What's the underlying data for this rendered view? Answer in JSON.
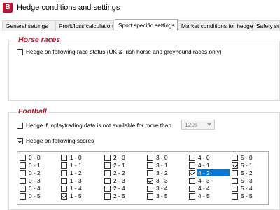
{
  "window": {
    "title": "Hedge conditions and settings",
    "icon_letter": "B"
  },
  "tabs": [
    {
      "label": "General settings",
      "active": false
    },
    {
      "label": "Profit/loss calculation",
      "active": false
    },
    {
      "label": "Sport specific settings",
      "active": true
    },
    {
      "label": "Market conditions for hedge",
      "active": false
    },
    {
      "label": "Safety se",
      "active": false
    }
  ],
  "horse_races": {
    "title": "Horse races",
    "race_status_option": {
      "label": "Hedge on following race status (UK & Irish horse and greyhound races only)",
      "checked": false
    }
  },
  "football": {
    "title": "Football",
    "inplay_option": {
      "label": "Hedge if Inplaytrading data is not available for more than",
      "checked": false
    },
    "timeout": {
      "value": "120s"
    },
    "scores_option": {
      "label": "Hedge on following scores",
      "checked": true
    },
    "scores_columns": [
      [
        {
          "label": "0 - 0",
          "checked": false
        },
        {
          "label": "0 - 1",
          "checked": false
        },
        {
          "label": "0 - 2",
          "checked": false
        },
        {
          "label": "0 - 3",
          "checked": false
        },
        {
          "label": "0 - 4",
          "checked": false
        },
        {
          "label": "0 - 5",
          "checked": false
        }
      ],
      [
        {
          "label": "1 - 0",
          "checked": false
        },
        {
          "label": "1 - 1",
          "checked": false
        },
        {
          "label": "1 - 2",
          "checked": false
        },
        {
          "label": "1 - 3",
          "checked": false
        },
        {
          "label": "1 - 4",
          "checked": false
        },
        {
          "label": "1 - 5",
          "checked": true
        }
      ],
      [
        {
          "label": "2 - 0",
          "checked": false
        },
        {
          "label": "2 - 1",
          "checked": false
        },
        {
          "label": "2 - 2",
          "checked": false
        },
        {
          "label": "2 - 3",
          "checked": false
        },
        {
          "label": "2 - 4",
          "checked": false
        },
        {
          "label": "2 - 5",
          "checked": false
        }
      ],
      [
        {
          "label": "3 - 0",
          "checked": false
        },
        {
          "label": "3 - 1",
          "checked": false
        },
        {
          "label": "3 - 2",
          "checked": false
        },
        {
          "label": "3 - 3",
          "checked": true
        },
        {
          "label": "3 - 4",
          "checked": false
        },
        {
          "label": "3 - 5",
          "checked": false
        }
      ],
      [
        {
          "label": "4 - 0",
          "checked": false
        },
        {
          "label": "4 - 1",
          "checked": false
        },
        {
          "label": "4 - 2",
          "checked": true,
          "selected": true
        },
        {
          "label": "4 - 3",
          "checked": false
        },
        {
          "label": "4 - 4",
          "checked": false
        },
        {
          "label": "4 - 5",
          "checked": false
        }
      ],
      [
        {
          "label": "5 - 0",
          "checked": false
        },
        {
          "label": "5 - 1",
          "checked": true
        },
        {
          "label": "5 - 2",
          "checked": false
        },
        {
          "label": "5 - 3",
          "checked": false
        },
        {
          "label": "5 - 4",
          "checked": false
        },
        {
          "label": "5 - 5",
          "checked": false
        }
      ]
    ]
  },
  "colors": {
    "accent_red": "#c8102e",
    "selection_blue": "#0078d7"
  }
}
